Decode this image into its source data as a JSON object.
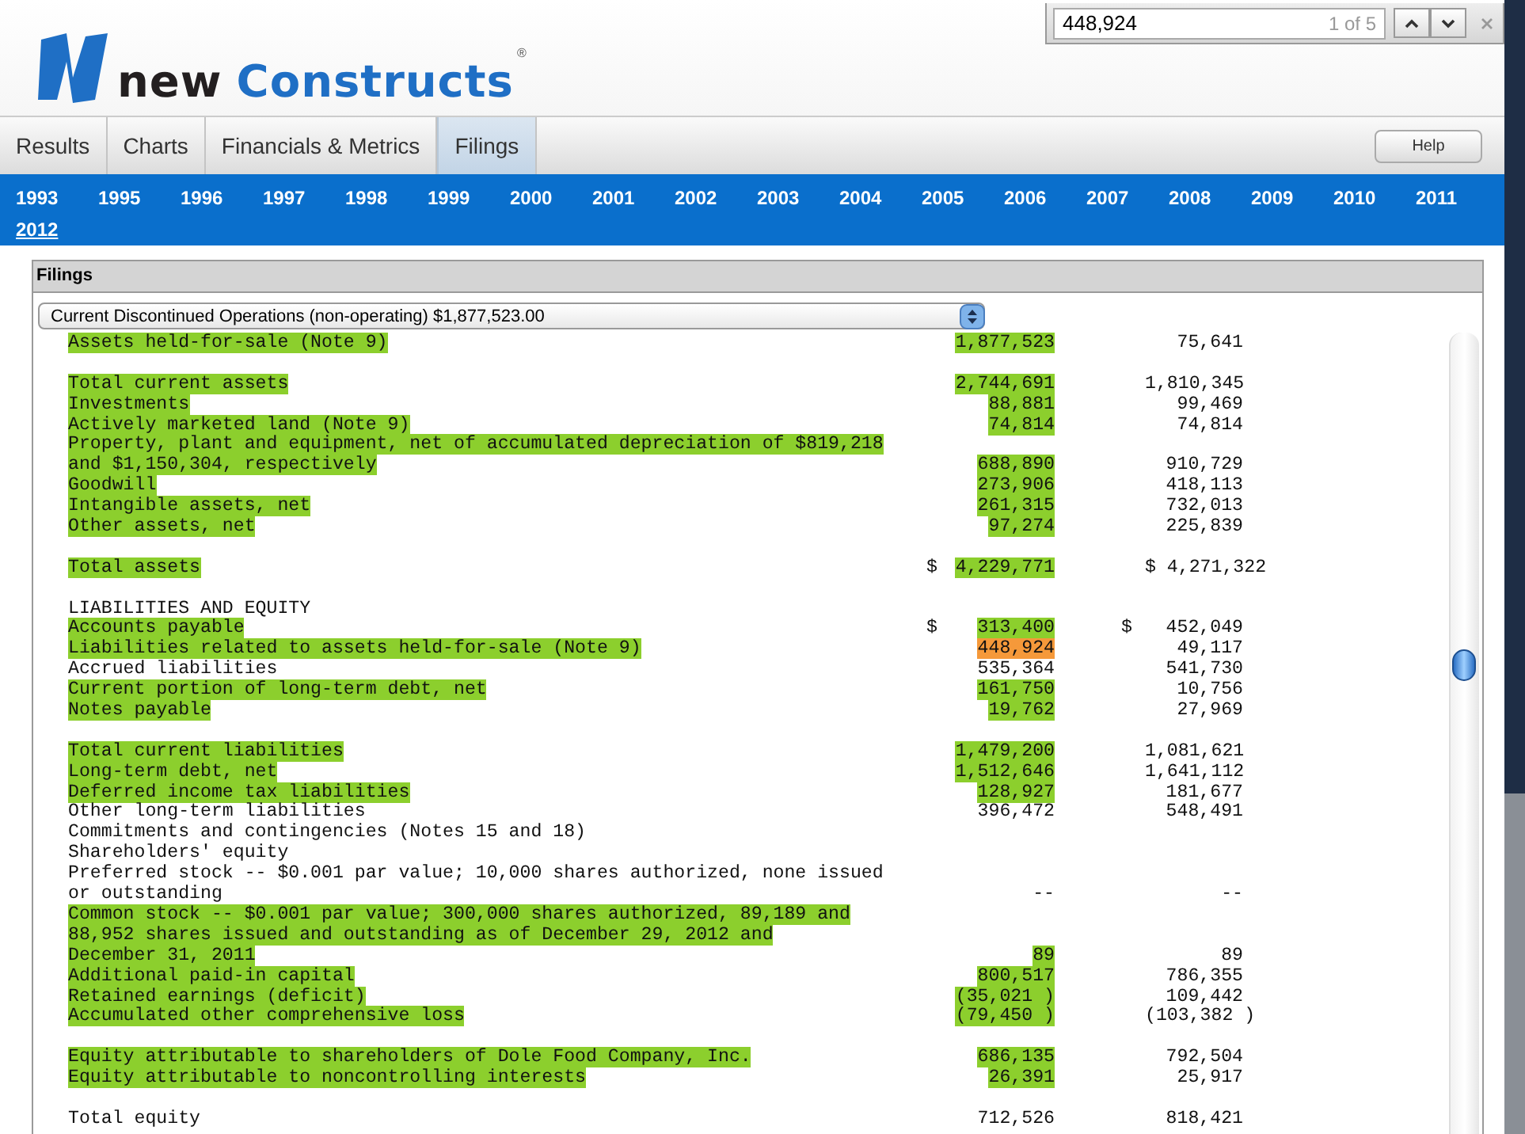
{
  "find_bar": {
    "query": "448,924",
    "count": "1 of 5"
  },
  "logo": {
    "word1": "new",
    "word2": "Constructs",
    "mark": "®"
  },
  "tabs": [
    {
      "label": "Results",
      "selected": false
    },
    {
      "label": "Charts",
      "selected": false
    },
    {
      "label": "Financials & Metrics",
      "selected": false
    },
    {
      "label": "Filings",
      "selected": true
    }
  ],
  "help_button": "Help",
  "years": [
    {
      "label": "1993",
      "selected": false
    },
    {
      "label": "1995",
      "selected": false
    },
    {
      "label": "1996",
      "selected": false
    },
    {
      "label": "1997",
      "selected": false
    },
    {
      "label": "1998",
      "selected": false
    },
    {
      "label": "1999",
      "selected": false
    },
    {
      "label": "2000",
      "selected": false
    },
    {
      "label": "2001",
      "selected": false
    },
    {
      "label": "2002",
      "selected": false
    },
    {
      "label": "2003",
      "selected": false
    },
    {
      "label": "2004",
      "selected": false
    },
    {
      "label": "2005",
      "selected": false
    },
    {
      "label": "2006",
      "selected": false
    },
    {
      "label": "2007",
      "selected": false
    },
    {
      "label": "2008",
      "selected": false
    },
    {
      "label": "2009",
      "selected": false
    },
    {
      "label": "2010",
      "selected": false
    },
    {
      "label": "2011",
      "selected": false
    },
    {
      "label": "2012",
      "selected": true
    }
  ],
  "panel": {
    "title": "Filings",
    "dropdown": "Current Discontinued Operations (non-operating) $1,877,523.00"
  },
  "lines": [
    {
      "kind": "line",
      "label": "Assets held-for-sale (Note 9)",
      "label_highlighted": true,
      "value_1": "1,877,523",
      "value_1_highlighted": true,
      "value_1_current": false,
      "value_2": "75,641"
    },
    {
      "kind": "blank"
    },
    {
      "kind": "line",
      "label": "Total current assets",
      "label_highlighted": true,
      "value_1": "2,744,691",
      "value_1_highlighted": true,
      "value_1_current": false,
      "value_2": "1,810,345"
    },
    {
      "kind": "line",
      "label": "Investments",
      "label_highlighted": true,
      "value_1": "88,881",
      "value_1_highlighted": true,
      "value_1_current": false,
      "value_2": "99,469"
    },
    {
      "kind": "line",
      "label": "Actively marketed land (Note 9)",
      "label_highlighted": true,
      "value_1": "74,814",
      "value_1_highlighted": true,
      "value_1_current": false,
      "value_2": "74,814"
    },
    {
      "kind": "line",
      "label": "Property, plant and equipment, net of accumulated depreciation of $819,218",
      "label_highlighted": true
    },
    {
      "kind": "line",
      "label": "and $1,150,304, respectively",
      "label_highlighted": true,
      "value_1": "688,890",
      "value_1_highlighted": true,
      "value_1_current": false,
      "value_2": "910,729"
    },
    {
      "kind": "line",
      "label": "Goodwill",
      "label_highlighted": true,
      "value_1": "273,906",
      "value_1_highlighted": true,
      "value_1_current": false,
      "value_2": "418,113"
    },
    {
      "kind": "line",
      "label": "Intangible assets, net",
      "label_highlighted": true,
      "value_1": "261,315",
      "value_1_highlighted": true,
      "value_1_current": false,
      "value_2": "732,013"
    },
    {
      "kind": "line",
      "label": "Other assets, net",
      "label_highlighted": true,
      "value_1": "97,274",
      "value_1_highlighted": true,
      "value_1_current": false,
      "value_2": "225,839"
    },
    {
      "kind": "blank"
    },
    {
      "kind": "line",
      "label": "Total assets",
      "label_highlighted": true,
      "prefix_1": "$",
      "value_1": "4,229,771",
      "value_1_highlighted": true,
      "value_1_current": false,
      "value_2": "$ 4,271,322"
    },
    {
      "kind": "blank"
    },
    {
      "kind": "line",
      "label": "LIABILITIES AND EQUITY",
      "label_highlighted": false
    },
    {
      "kind": "line",
      "label": "Accounts payable",
      "label_highlighted": true,
      "prefix_1": "$",
      "value_1": "313,400",
      "value_1_highlighted": true,
      "value_1_current": false,
      "prefix_2": "$",
      "value_2": "452,049"
    },
    {
      "kind": "line",
      "label": "Liabilities related to assets held-for-sale (Note 9)",
      "label_highlighted": true,
      "value_1": "448,924",
      "value_1_highlighted": false,
      "value_1_current": true,
      "value_2": "49,117"
    },
    {
      "kind": "line",
      "label": "Accrued liabilities",
      "label_highlighted": false,
      "value_1": "535,364",
      "value_1_highlighted": false,
      "value_1_current": false,
      "value_2": "541,730"
    },
    {
      "kind": "line",
      "label": "Current portion of long-term debt, net",
      "label_highlighted": true,
      "value_1": "161,750",
      "value_1_highlighted": true,
      "value_1_current": false,
      "value_2": "10,756"
    },
    {
      "kind": "line",
      "label": "Notes payable",
      "label_highlighted": true,
      "value_1": "19,762",
      "value_1_highlighted": true,
      "value_1_current": false,
      "value_2": "27,969"
    },
    {
      "kind": "blank"
    },
    {
      "kind": "line",
      "label": "Total current liabilities",
      "label_highlighted": true,
      "value_1": "1,479,200",
      "value_1_highlighted": true,
      "value_1_current": false,
      "value_2": "1,081,621"
    },
    {
      "kind": "line",
      "label": "Long-term debt, net",
      "label_highlighted": true,
      "value_1": "1,512,646",
      "value_1_highlighted": true,
      "value_1_current": false,
      "value_2": "1,641,112"
    },
    {
      "kind": "line",
      "label": "Deferred income tax liabilities",
      "label_highlighted": true,
      "value_1": "128,927",
      "value_1_highlighted": true,
      "value_1_current": false,
      "value_2": "181,677"
    },
    {
      "kind": "line",
      "label": "Other long-term liabilities",
      "label_highlighted": false,
      "value_1": "396,472",
      "value_1_highlighted": false,
      "value_1_current": false,
      "value_2": "548,491"
    },
    {
      "kind": "line",
      "label": "Commitments and contingencies (Notes 15 and 18)",
      "label_highlighted": false
    },
    {
      "kind": "line",
      "label": "Shareholders' equity",
      "label_highlighted": false
    },
    {
      "kind": "line",
      "label": "Preferred stock -- $0.001 par value; 10,000 shares authorized, none issued",
      "label_highlighted": false
    },
    {
      "kind": "line",
      "label": "or outstanding",
      "label_highlighted": false,
      "value_1": "--",
      "value_1_highlighted": false,
      "value_1_current": false,
      "value_2": "--"
    },
    {
      "kind": "line",
      "label": "Common stock -- $0.001 par value; 300,000 shares authorized, 89,189 and",
      "label_highlighted": true
    },
    {
      "kind": "line",
      "label": "88,952 shares issued and outstanding as of December 29, 2012 and",
      "label_highlighted": true
    },
    {
      "kind": "line",
      "label": "December 31, 2011",
      "label_highlighted": true,
      "value_1": "89",
      "value_1_highlighted": true,
      "value_1_current": false,
      "value_2": "89"
    },
    {
      "kind": "line",
      "label": "Additional paid-in capital",
      "label_highlighted": true,
      "value_1": "800,517",
      "value_1_highlighted": true,
      "value_1_current": false,
      "value_2": "786,355"
    },
    {
      "kind": "line",
      "label": "Retained earnings (deficit)",
      "label_highlighted": true,
      "value_1": "(35,021 )",
      "value_1_highlighted": true,
      "value_1_current": false,
      "value_2": "109,442"
    },
    {
      "kind": "line",
      "label": "Accumulated other comprehensive loss",
      "label_highlighted": true,
      "value_1": "(79,450 )",
      "value_1_highlighted": true,
      "value_1_current": false,
      "value_2": "(103,382 )"
    },
    {
      "kind": "blank"
    },
    {
      "kind": "line",
      "label": "Equity attributable to shareholders of Dole Food Company, Inc.",
      "label_highlighted": true,
      "value_1": "686,135",
      "value_1_highlighted": true,
      "value_1_current": false,
      "value_2": "792,504"
    },
    {
      "kind": "line",
      "label": "Equity attributable to noncontrolling interests",
      "label_highlighted": true,
      "value_1": "26,391",
      "value_1_highlighted": true,
      "value_1_current": false,
      "value_2": "25,917"
    },
    {
      "kind": "blank"
    },
    {
      "kind": "line",
      "label": "Total equity",
      "label_highlighted": false,
      "value_1": "712,526",
      "value_1_highlighted": false,
      "value_1_current": false,
      "value_2": "818,421"
    }
  ]
}
